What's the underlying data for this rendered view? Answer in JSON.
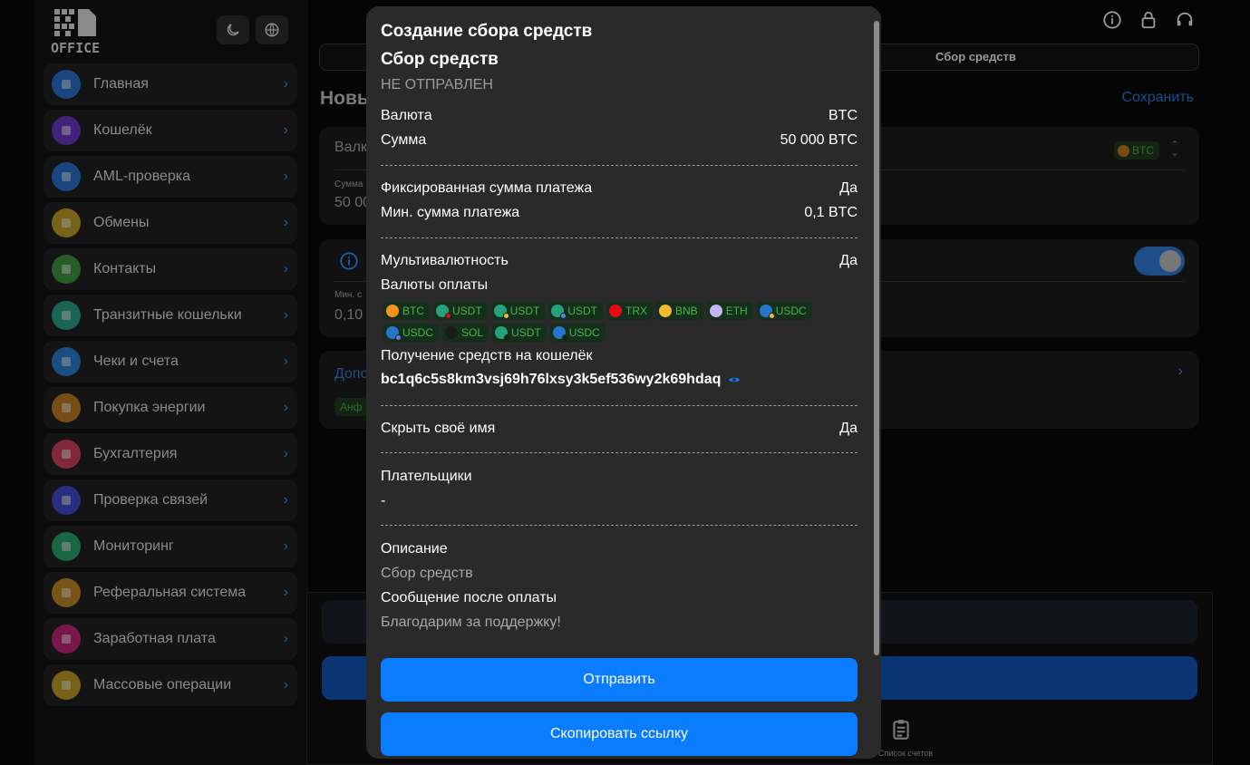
{
  "sidebar": {
    "logo_text": "OFFICE",
    "theme_icon": "moon-icon",
    "lang_icon": "globe-icon",
    "items": [
      {
        "label": "Главная",
        "icon": "home-icon",
        "color": "#1e6fd9"
      },
      {
        "label": "Кошелёк",
        "icon": "wallet-icon",
        "color": "#6a2fd0"
      },
      {
        "label": "AML-проверка",
        "icon": "shield-icon",
        "color": "#1e6fd9"
      },
      {
        "label": "Обмены",
        "icon": "exchange-icon",
        "color": "#c8a21a"
      },
      {
        "label": "Контакты",
        "icon": "contact-card-icon",
        "color": "#3a9a3a"
      },
      {
        "label": "Транзитные кошельки",
        "icon": "truck-icon",
        "color": "#1fa88a"
      },
      {
        "label": "Чеки и счета",
        "icon": "receipt-icon",
        "color": "#1e7fd9"
      },
      {
        "label": "Покупка энергии",
        "icon": "bolt-icon",
        "color": "#c87a1a"
      },
      {
        "label": "Бухгалтерия",
        "icon": "briefcase-icon",
        "color": "#d93a5a"
      },
      {
        "label": "Проверка связей",
        "icon": "puzzle-icon",
        "color": "#3a46d9"
      },
      {
        "label": "Мониторинг",
        "icon": "monitor-icon",
        "color": "#1fa86a"
      },
      {
        "label": "Реферальная система",
        "icon": "handshake-icon",
        "color": "#c88a1a"
      },
      {
        "label": "Заработная плата",
        "icon": "payroll-icon",
        "color": "#c81a7a"
      },
      {
        "label": "Массовые операции",
        "icon": "bulk-ops-icon",
        "color": "#c8a21a"
      }
    ]
  },
  "topbar": {
    "icons": [
      "info-icon",
      "lock-icon",
      "support-icon"
    ]
  },
  "main": {
    "tab_right": "Сбор средств",
    "heading": "Новы",
    "save": "Сохранить",
    "card1_label": "Валк",
    "card1_sum_label": "Сумма",
    "card1_sum_value": "50 00",
    "card1_currency": "BTC",
    "card2_min_label": "Мин. с",
    "card2_min_value": "0,10",
    "card3_label": "Допо",
    "card3_tag": "Анф",
    "bottom_tab": "Список счетов"
  },
  "modal": {
    "title": "Создание сбора средств",
    "subtitle": "Сбор средств",
    "status": "НЕ ОТПРАВЛЕН",
    "currency_label": "Валюта",
    "currency_value": "BTC",
    "amount_label": "Сумма",
    "amount_value": "50 000 BTC",
    "fixed_label": "Фиксированная сумма платежа",
    "fixed_value": "Да",
    "min_label": "Мин. сумма платежа",
    "min_value": "0,1 BTC",
    "multi_label": "Мультивалютность",
    "multi_value": "Да",
    "pay_currencies_label": "Валюты оплаты",
    "chips_row1": [
      {
        "text": "BTC",
        "coin": "#f7931a",
        "net": ""
      },
      {
        "text": "USDT",
        "coin": "#26a17b",
        "net": "#e50915"
      },
      {
        "text": "USDT",
        "coin": "#26a17b",
        "net": "#f3ba2f"
      },
      {
        "text": "USDT",
        "coin": "#26a17b",
        "net": "#627eea"
      },
      {
        "text": "TRX",
        "coin": "#e50915",
        "net": ""
      },
      {
        "text": "BNB",
        "coin": "#f3ba2f",
        "net": ""
      },
      {
        "text": "ETH",
        "coin": "#c6b5f5",
        "net": ""
      },
      {
        "text": "USDC",
        "coin": "#2775ca",
        "net": "#f3ba2f"
      }
    ],
    "chips_row2": [
      {
        "text": "USDC",
        "coin": "#2775ca",
        "net": "#627eea"
      },
      {
        "text": "SOL",
        "coin": "#1b1b1b",
        "net": ""
      },
      {
        "text": "USDT",
        "coin": "#26a17b",
        "net": "#1b1b1b"
      },
      {
        "text": "USDC",
        "coin": "#2775ca",
        "net": "#1b1b1b"
      }
    ],
    "receive_label": "Получение средств на кошелёк",
    "wallet_address": "bc1q6c5s8km3vsj69h76lxsy3k5ef536wy2k69hdaq",
    "hide_name_label": "Скрыть своё имя",
    "hide_name_value": "Да",
    "payers_label": "Плательщики",
    "payers_value": "-",
    "description_label": "Описание",
    "description_value": "Сбор средств",
    "after_pay_label": "Сообщение после оплаты",
    "after_pay_value": "Благодарим за поддержку!",
    "send_button": "Отправить",
    "copy_button": "Скопировать ссылку"
  },
  "colors": {
    "overlay": "#050505",
    "modal_bg": "#2a2a2a",
    "accent": "#0a7cff",
    "chip_bg": "#15301a",
    "chip_text": "#45b54a"
  }
}
